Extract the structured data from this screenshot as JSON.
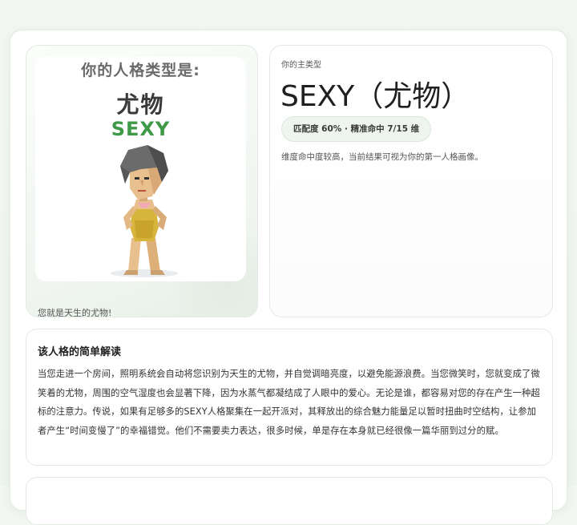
{
  "poster": {
    "heading": "你的人格类型是:",
    "name_cn": "尤物",
    "name_en": "SEXY",
    "caption": "您就是天生的尤物!"
  },
  "type_card": {
    "kicker": "你的主类型",
    "title": "SEXY（尤物）",
    "match_pill": "匹配度 60% · 精准命中 7/15 维",
    "note": "维度命中度较高，当前结果可视为你的第一人格画像。"
  },
  "description": {
    "title": "该人格的简单解读",
    "body": "当您走进一个房间，照明系统会自动将您识别为天生的尤物，并自觉调暗亮度，以避免能源浪费。当您微笑时，您就变成了微笑着的尤物，周围的空气湿度也会显著下降，因为水蒸气都凝结成了人眼中的爱心。无论是谁，都容易对您的存在产生一种超标的注意力。传说，如果有足够多的SEXY人格聚集在一起开派对，其释放出的综合魅力能量足以暂时扭曲时空结构，让参加者产生“时间变慢了”的幸福错觉。他们不需要卖力表达，很多时候，单是存在本身就已经很像一篇华丽到过分的赋。"
  },
  "colors": {
    "accent_green": "#3f9a48",
    "pill_bg": "#eef4ee"
  }
}
